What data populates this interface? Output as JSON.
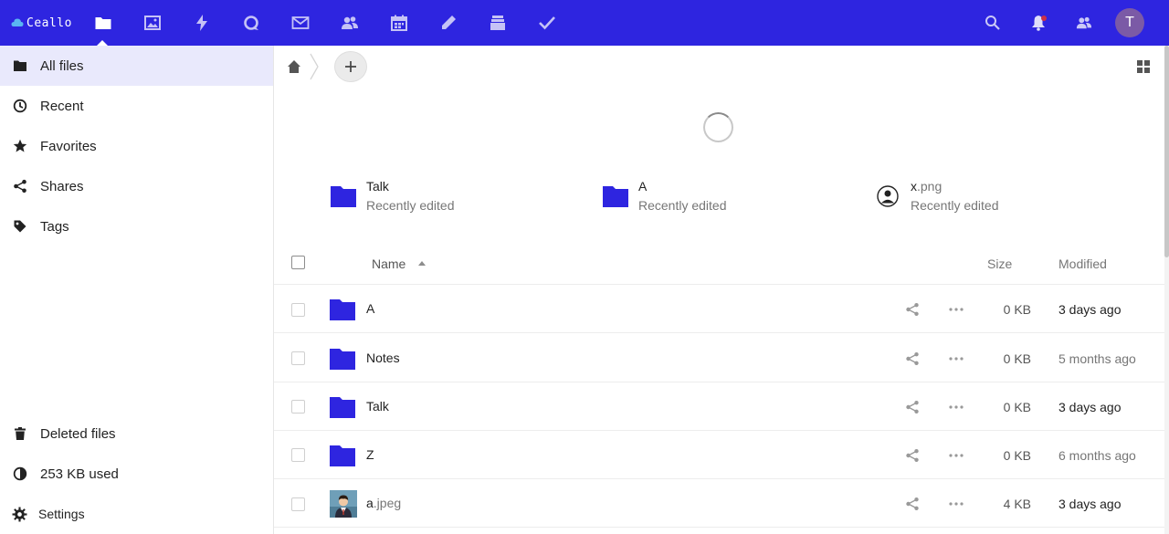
{
  "header": {
    "brand": "Ceallo",
    "apps": [
      {
        "icon": "files-icon",
        "name": "Files"
      },
      {
        "icon": "photos-icon",
        "name": "Photos"
      },
      {
        "icon": "activity-icon",
        "name": "Activity"
      },
      {
        "icon": "talk-icon",
        "name": "Talk"
      },
      {
        "icon": "mail-icon",
        "name": "Mail"
      },
      {
        "icon": "contacts-icon",
        "name": "Contacts"
      },
      {
        "icon": "calendar-icon",
        "name": "Calendar"
      },
      {
        "icon": "notes-icon",
        "name": "Notes"
      },
      {
        "icon": "deck-icon",
        "name": "Deck"
      },
      {
        "icon": "tasks-icon",
        "name": "Tasks"
      }
    ],
    "avatar_initial": "T"
  },
  "sidebar": {
    "items": [
      {
        "label": "All files",
        "icon": "folder-icon"
      },
      {
        "label": "Recent",
        "icon": "clock-icon"
      },
      {
        "label": "Favorites",
        "icon": "star-icon"
      },
      {
        "label": "Shares",
        "icon": "share-icon"
      },
      {
        "label": "Tags",
        "icon": "tag-icon"
      }
    ],
    "bottom": {
      "deleted": "Deleted files",
      "quota": "253 KB used",
      "settings": "Settings"
    }
  },
  "recent": [
    {
      "name": "Talk",
      "ext": "",
      "sub": "Recently edited",
      "type": "folder"
    },
    {
      "name": "A",
      "ext": "",
      "sub": "Recently edited",
      "type": "folder"
    },
    {
      "name": "x",
      "ext": ".png",
      "sub": "Recently edited",
      "type": "image"
    }
  ],
  "table": {
    "columns": {
      "name": "Name",
      "size": "Size",
      "modified": "Modified"
    },
    "rows": [
      {
        "name": "A",
        "ext": "",
        "size": "0 KB",
        "modified": "3 days ago",
        "type": "folder"
      },
      {
        "name": "Notes",
        "ext": "",
        "size": "0 KB",
        "modified": "5 months ago",
        "type": "folder"
      },
      {
        "name": "Talk",
        "ext": "",
        "size": "0 KB",
        "modified": "3 days ago",
        "type": "folder"
      },
      {
        "name": "Z",
        "ext": "",
        "size": "0 KB",
        "modified": "6 months ago",
        "type": "folder"
      },
      {
        "name": "a",
        "ext": ".jpeg",
        "size": "4 KB",
        "modified": "3 days ago",
        "type": "image"
      }
    ]
  },
  "colors": {
    "brand": "#2e25e0",
    "active_nav": "#e9e9fc",
    "folder": "#2e25e0"
  }
}
